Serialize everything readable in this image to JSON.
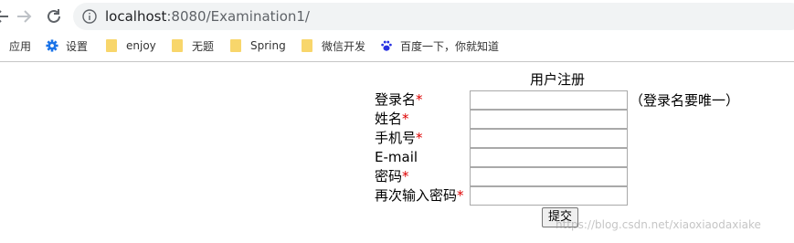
{
  "browser": {
    "url_host": "localhost",
    "url_rest": ":8080/Examination1/",
    "bookmarks": [
      {
        "label": "应用",
        "icon": "apps-icon"
      },
      {
        "label": "设置",
        "icon": "gear-icon"
      },
      {
        "label": "enjoy",
        "icon": "folder-icon"
      },
      {
        "label": "无题",
        "icon": "folder-icon"
      },
      {
        "label": "Spring",
        "icon": "folder-icon"
      },
      {
        "label": "微信开发",
        "icon": "folder-icon"
      },
      {
        "label": "百度一下，你就知道",
        "icon": "baidu-paw-icon"
      }
    ]
  },
  "form": {
    "title": "用户注册",
    "required_mark": "*",
    "fields": [
      {
        "label": "登录名",
        "required": true,
        "value": ""
      },
      {
        "label": "姓名",
        "required": true,
        "value": ""
      },
      {
        "label": "手机号",
        "required": true,
        "value": ""
      },
      {
        "label": "E-mail",
        "required": false,
        "value": ""
      },
      {
        "label": "密码",
        "required": true,
        "value": ""
      },
      {
        "label": "再次输入密码",
        "required": true,
        "value": ""
      }
    ],
    "login_hint": "（登录名要唯一）",
    "submit_label": "提交"
  },
  "watermark": "https://blog.csdn.net/xiaoxiaodaxiake",
  "colors": {
    "required": "#dd0000",
    "gear": "#1a73e8",
    "baidu": "#2932e1",
    "folder": "#f8d66b"
  }
}
